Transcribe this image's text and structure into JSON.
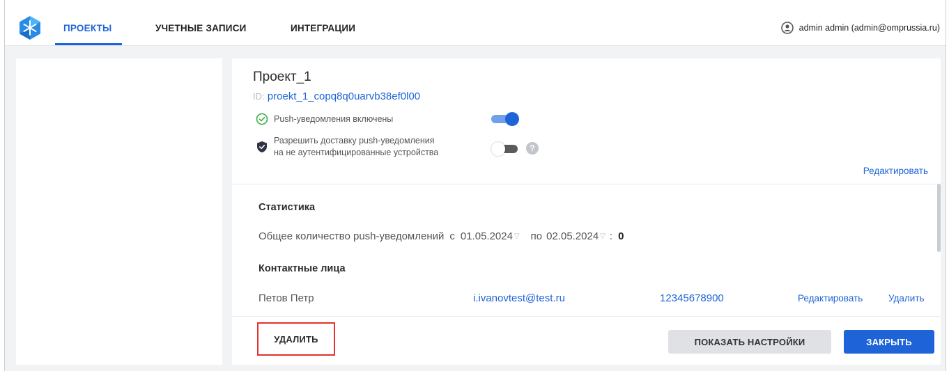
{
  "header": {
    "tabs": [
      {
        "label": "ПРОЕКТЫ",
        "active": true
      },
      {
        "label": "УЧЕТНЫЕ ЗАПИСИ",
        "active": false
      },
      {
        "label": "ИНТЕГРАЦИИ",
        "active": false
      }
    ],
    "user": "admin admin (admin@omprussia.ru)",
    "user_icon": "account-circle-icon",
    "logo_icon": "snowflake-logo"
  },
  "project": {
    "title": "Проект_1",
    "id_label": "ID:",
    "id_value": "proekt_1_copq8q0uarvb38ef0l00",
    "push_status": "Push-уведомления включены",
    "push_enabled": true,
    "allow_delivery_line1": "Разрешить доставку push-уведомления",
    "allow_delivery_line2": "на не аутентифицированные устройства",
    "allow_delivery_enabled": false,
    "edit_label": "Редактировать"
  },
  "statistics": {
    "title": "Статистика",
    "total_label": "Общее количество push-уведомлений",
    "from_label": "с",
    "from_date": "01.05.2024",
    "to_label": "по",
    "to_date": "02.05.2024",
    "separator": ":",
    "count": "0"
  },
  "contacts": {
    "title": "Контактные лица",
    "rows": [
      {
        "name": "Петов Петр",
        "email": "i.ivanovtest@test.ru",
        "phone": "12345678900",
        "edit_label": "Редактировать",
        "delete_label": "Удалить"
      }
    ]
  },
  "footer": {
    "delete_label": "УДАЛИТЬ",
    "show_settings_label": "ПОКАЗАТЬ НАСТРОЙКИ",
    "close_label": "ЗАКРЫТЬ"
  },
  "colors": {
    "accent": "#1e64d8",
    "highlight_border": "#e3312f",
    "success": "#3cb043"
  }
}
